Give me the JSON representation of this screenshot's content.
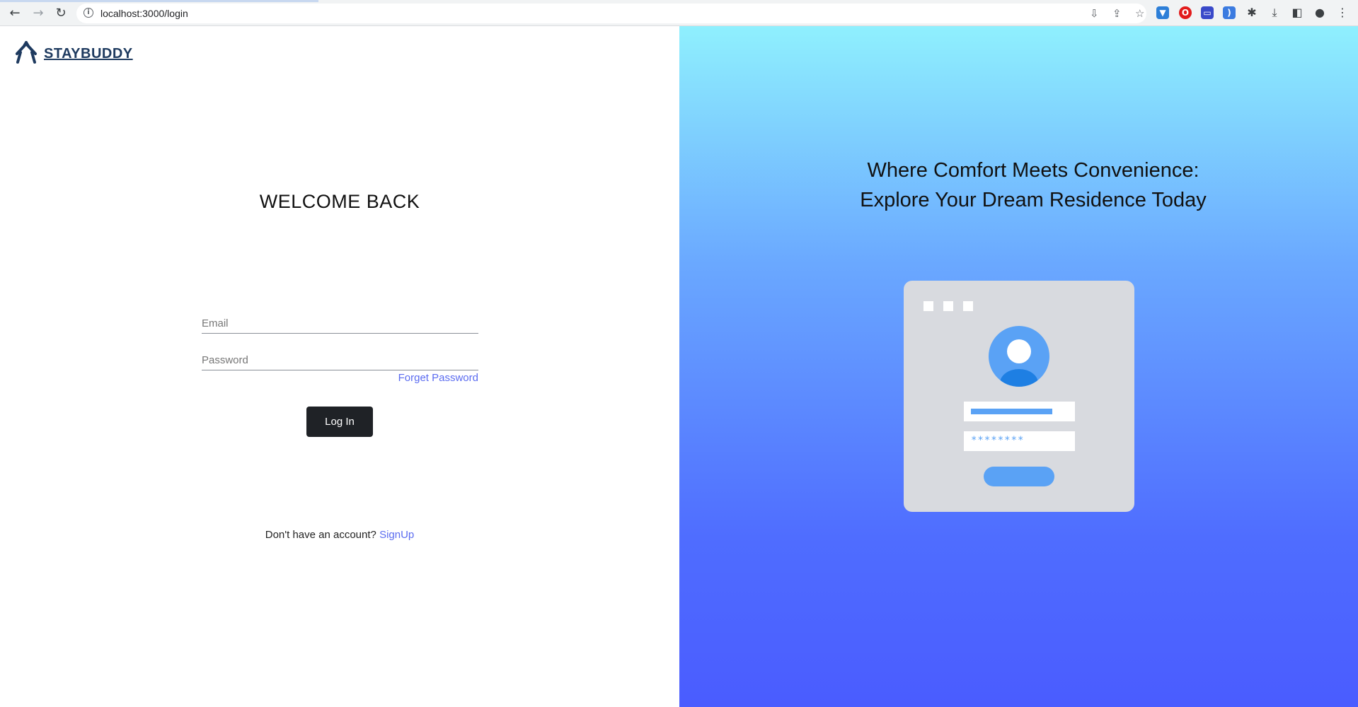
{
  "browser": {
    "url": "localhost:3000/login"
  },
  "header": {
    "logo_text": "STAYBUDDY"
  },
  "login": {
    "title": "WELCOME BACK",
    "email_placeholder": "Email",
    "password_placeholder": "Password",
    "forget_password": "Forget Password",
    "login_button": "Log In",
    "signup_prompt": "Don't have an account?",
    "signup_link": "SignUp"
  },
  "hero": {
    "tagline_line1": "Where Comfort Meets Convenience:",
    "tagline_line2": "Explore Your Dream Residence Today",
    "password_mask": "********"
  },
  "colors": {
    "brand": "#1e3a5f",
    "link": "#5b6cf0",
    "button": "#1f2226",
    "illustration_accent": "#5aa2f5"
  }
}
